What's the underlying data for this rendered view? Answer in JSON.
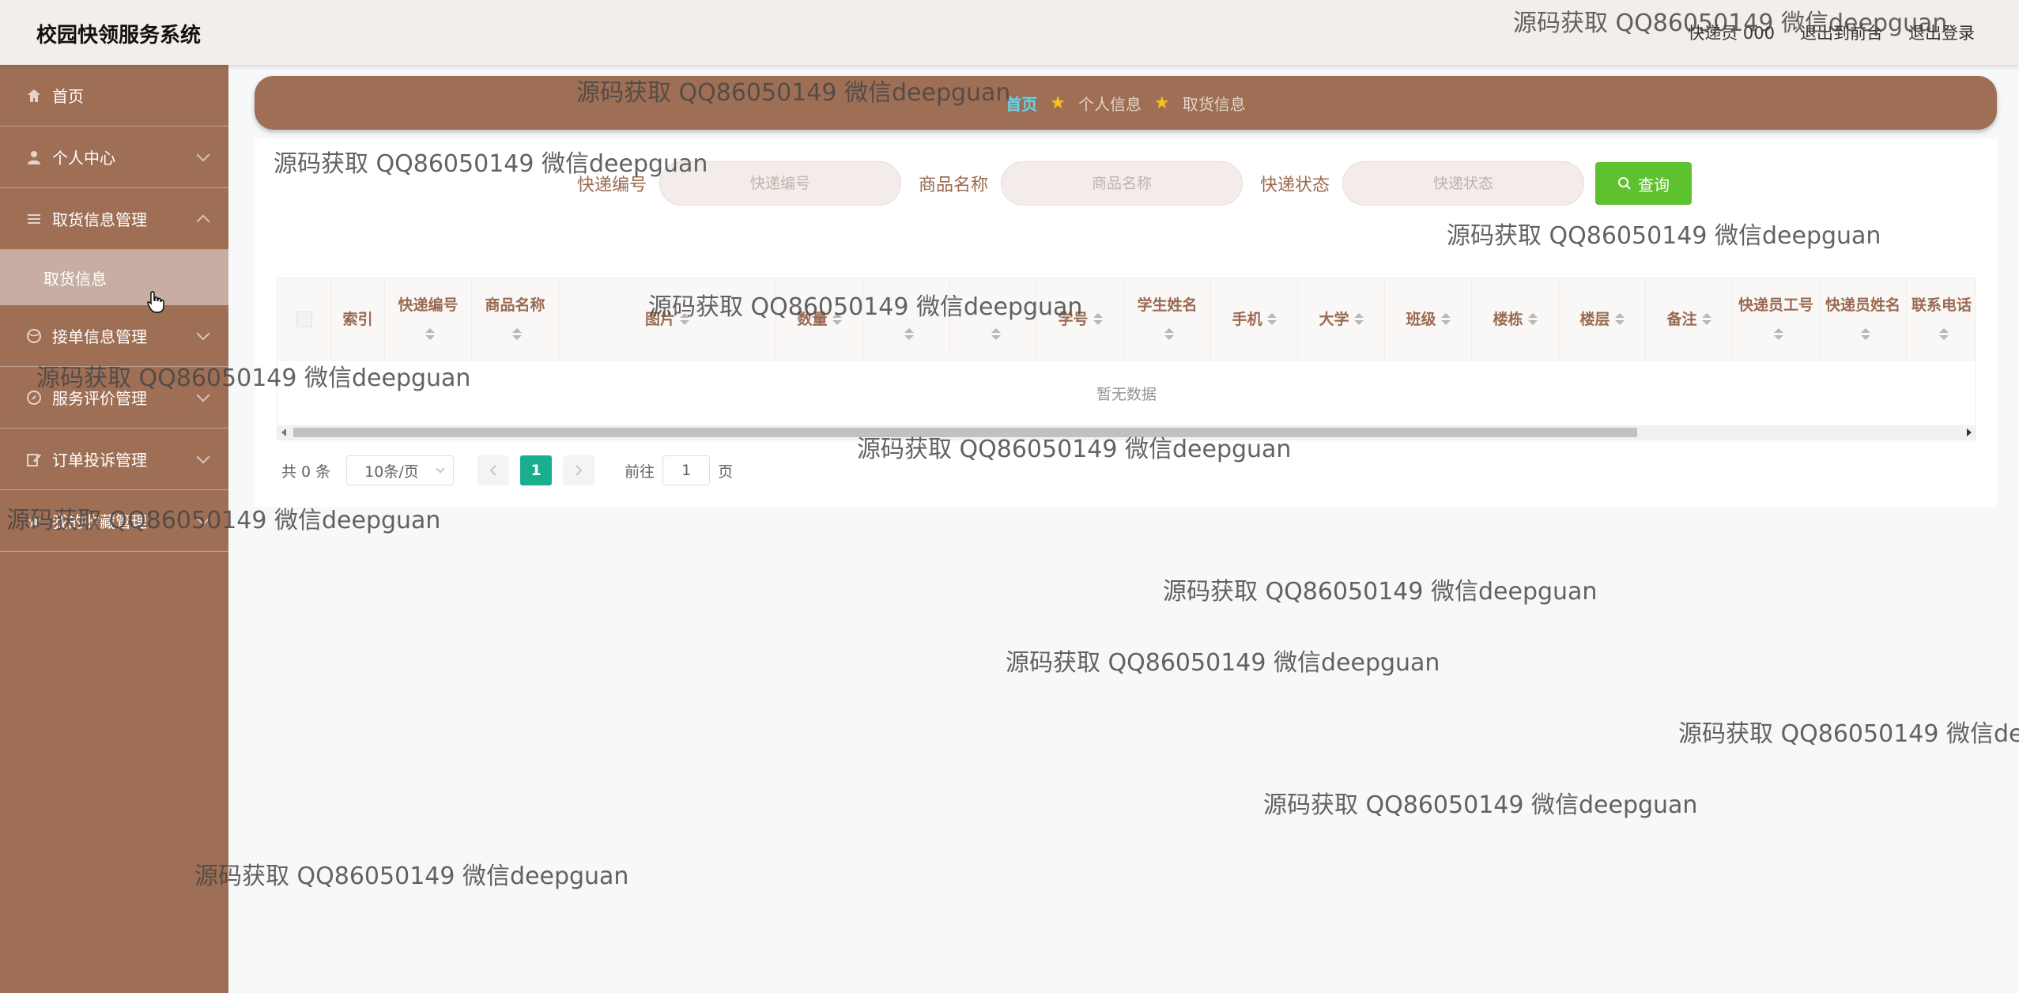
{
  "header": {
    "app_title": "校园快领服务系统",
    "user_label": "快递员 000",
    "front_link": "退出到前台",
    "logout_link": "退出登录"
  },
  "sidebar": {
    "items": [
      {
        "label": "首页",
        "icon": "home-icon"
      },
      {
        "label": "个人中心",
        "icon": "user-icon"
      },
      {
        "label": "取货信息管理",
        "icon": "list-icon"
      },
      {
        "label": "取货信息",
        "icon": ""
      },
      {
        "label": "接单信息管理",
        "icon": "ball-icon"
      },
      {
        "label": "服务评价管理",
        "icon": "compass-icon"
      },
      {
        "label": "订单投诉管理",
        "icon": "edit-icon"
      },
      {
        "label": "我的收藏管理",
        "icon": "star-icon"
      }
    ]
  },
  "breadcrumb": {
    "items": [
      "首页",
      "个人信息",
      "取货信息"
    ]
  },
  "search": {
    "field1_label": "快递编号",
    "field1_placeholder": "快递编号",
    "field2_label": "商品名称",
    "field2_placeholder": "商品名称",
    "field3_label": "快递状态",
    "field3_placeholder": "快递状态",
    "button_label": "查询"
  },
  "table": {
    "columns": [
      "索引",
      "快递编号",
      "商品名称",
      "图片",
      "数量",
      "",
      "",
      "学号",
      "学生姓名",
      "手机",
      "大学",
      "班级",
      "楼栋",
      "楼层",
      "备注",
      "快递员工号",
      "快递员姓名",
      "联系电话"
    ],
    "empty_text": "暂无数据"
  },
  "pagination": {
    "total": "共 0 条",
    "page_size": "10条/页",
    "current_page": "1",
    "goto_label": "前往",
    "goto_value": "1",
    "page_unit": "页"
  },
  "watermark": "源码获取 QQ86050149 微信deepguan",
  "colors": {
    "sidebar": "#9f6f55",
    "header": "#f4eeeb",
    "accent_green": "#5ec22f",
    "page_active": "#1aae8c"
  }
}
